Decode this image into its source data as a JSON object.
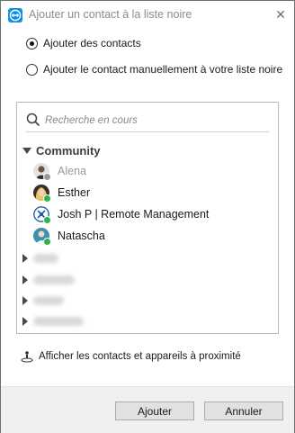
{
  "window": {
    "title": "Ajouter un contact à la liste noire",
    "close_glyph": "✕"
  },
  "options": {
    "add_contacts": "Ajouter des contacts",
    "add_manual": "Ajouter le contact manuellement à votre liste noire",
    "selected": "add_contacts"
  },
  "search": {
    "placeholder": "Recherche en cours",
    "value": ""
  },
  "group": {
    "name": "Community",
    "contacts": [
      {
        "name": "Alena",
        "status": "offline",
        "status_color": "#9a9a9a"
      },
      {
        "name": "Esther",
        "status": "online",
        "status_color": "#2fb34a"
      },
      {
        "name": "Josh P | Remote Management",
        "status": "online",
        "status_color": "#2fb34a"
      },
      {
        "name": "Natascha",
        "status": "online",
        "status_color": "#2fb34a"
      }
    ]
  },
  "collapsed_groups": [
    {
      "label": "",
      "blurred": true
    },
    {
      "label": "",
      "blurred": true
    },
    {
      "label": "",
      "blurred": true
    },
    {
      "label": "",
      "blurred": true
    }
  ],
  "nearby": {
    "label": "Afficher les contacts et appareils à proximité"
  },
  "buttons": {
    "add": "Ajouter",
    "cancel": "Annuler"
  },
  "colors": {
    "brand": "#0e8ee9",
    "online": "#2fb34a",
    "offline": "#9a9a9a"
  }
}
